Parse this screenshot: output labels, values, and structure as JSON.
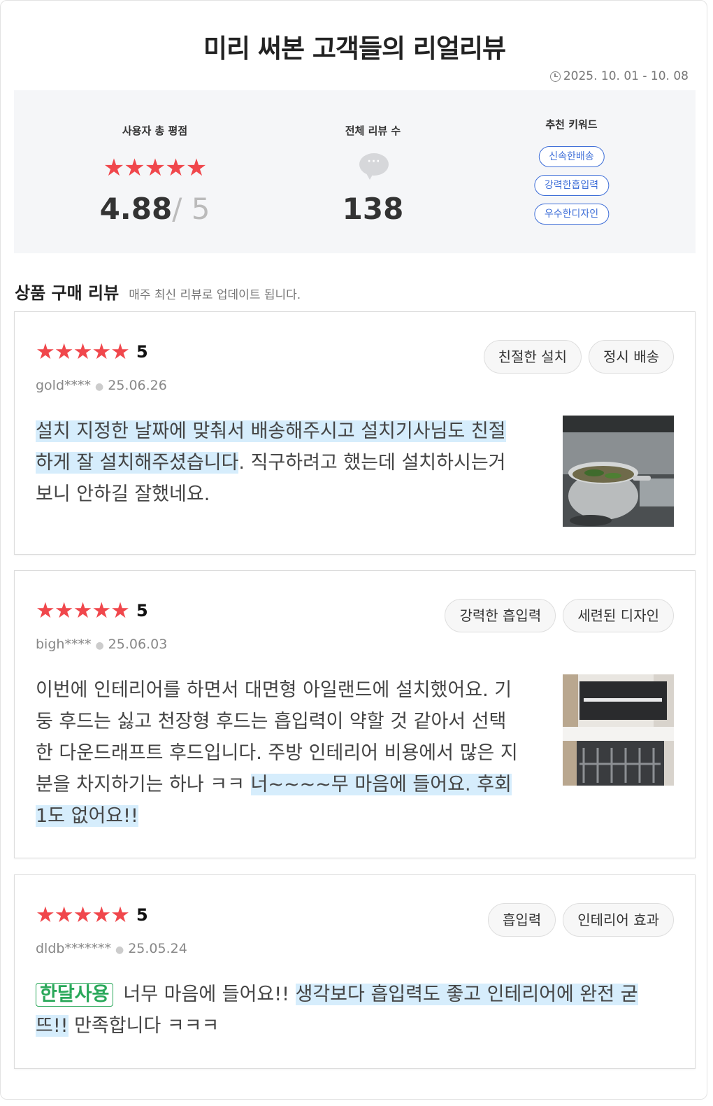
{
  "header": {
    "title": "미리 써본 고객들의 리얼리뷰",
    "period": "2025. 10. 01 - 10. 08"
  },
  "summary": {
    "rating_label": "사용자 총 평점",
    "rating_stars": "★★★★★",
    "rating_value": "4.88",
    "rating_max": "/ 5",
    "count_label": "전체 리뷰 수",
    "count_value": "138",
    "keywords_label": "추천 키워드",
    "keywords": [
      "신속한배송",
      "강력한흡입력",
      "우수한디자인"
    ]
  },
  "section": {
    "title": "상품 구매 리뷰",
    "subtitle": "매주 최신 리뷰로 업데이트 됩니다."
  },
  "reviews": [
    {
      "stars": "★★★★★",
      "score": "5",
      "user": "gold****",
      "date": "25.06.26",
      "tags": [
        "친절한 설치",
        "정시 배송"
      ],
      "highlight_text": "설치 지정한 날짜에 맞춰서 배송해주시고 설치기사님도 친절하게 잘 설치해주셨습니다",
      "text_rest": ". 직구하려고 했는데 설치하시는거 보니 안하길 잘했네요."
    },
    {
      "stars": "★★★★★",
      "score": "5",
      "user": "bigh****",
      "date": "25.06.03",
      "tags": [
        "강력한 흡입력",
        "세련된 디자인"
      ],
      "text_plain": "이번에 인테리어를 하면서 대면형 아일랜드에 설치했어요. 기둥 후드는 싫고 천장형 후드는 흡입력이 약할 것 같아서 선택한 다운드래프트 후드입니다. 주방 인테리어 비용에서 많은 지분을 차지하기는 하나 ㅋㅋ ",
      "highlight_text": "너~~~~무 마음에 들어요. 후회 1도 없어요!!"
    },
    {
      "stars": "★★★★★",
      "score": "5",
      "user": "dldb*******",
      "date": "25.05.24",
      "tags": [
        "흡입력",
        "인테리어 효과"
      ],
      "badge": "한달사용",
      "text_plain": "너무 마음에 들어요!! ",
      "highlight_text": "생각보다 흡입력도 좋고 인테리어에 완전 굳뜨!!",
      "text_rest": " 만족합니다 ㅋㅋㅋ"
    }
  ]
}
